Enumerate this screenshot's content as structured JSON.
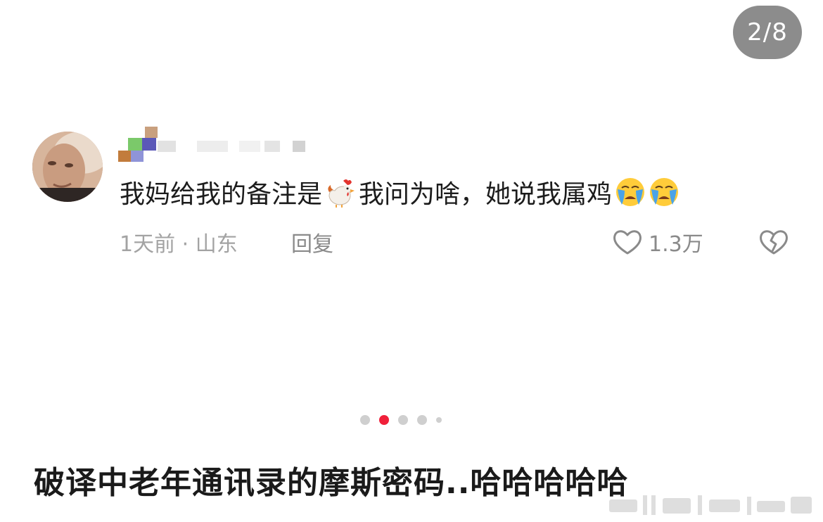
{
  "page_counter": "2/8",
  "comment": {
    "text_before": "我妈给我的备注是",
    "text_after": "我问为啥，她说我属鸡",
    "emoji_1": "rooster-emoji",
    "emoji_2": "crying-face-emoji",
    "emoji_3": "crying-face-emoji",
    "time_location": "1天前 · 山东",
    "reply_label": "回复",
    "like_count": "1.3万"
  },
  "carousel": {
    "total_dots": 5,
    "active_index": 1
  },
  "caption": "破译中老年通讯录的摩斯密码..哈哈哈哈哈",
  "colors": {
    "counter_bg": "#8c8c8c",
    "active_dot": "#f0203a",
    "inactive_dot": "#cfcfcf",
    "meta_text": "#a3a3a3"
  }
}
